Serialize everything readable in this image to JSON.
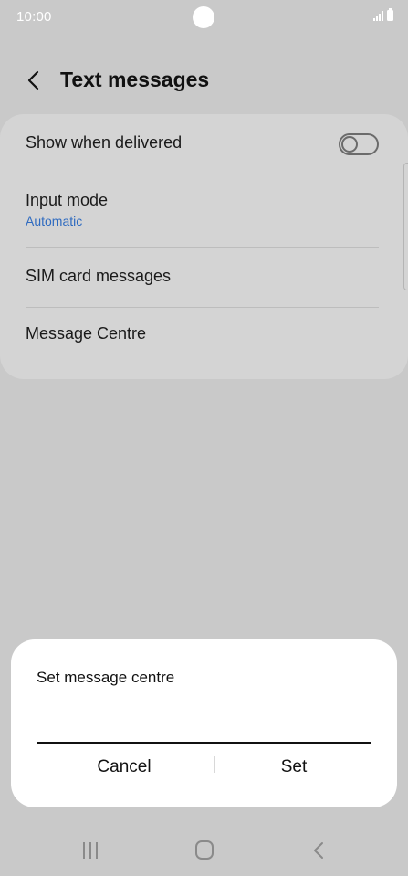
{
  "status_bar": {
    "time": "10:00",
    "icons": [
      "signal-icon",
      "battery-icon"
    ],
    "color": "#ffffff"
  },
  "header": {
    "back_icon": "chevron-left-icon",
    "title": "Text messages"
  },
  "settings": {
    "items": [
      {
        "title": "Show when delivered",
        "toggle": false
      },
      {
        "title": "Input mode",
        "subtitle": "Automatic"
      },
      {
        "title": "SIM card messages"
      },
      {
        "title": "Message Centre"
      }
    ],
    "subtitle_color": "#2f6bc0"
  },
  "dialog": {
    "title": "Set message centre",
    "input_value": "",
    "cancel_label": "Cancel",
    "set_label": "Set"
  },
  "nav_bar": {
    "icons": [
      "recent-apps-icon",
      "home-icon",
      "back-icon"
    ]
  },
  "colors": {
    "background_overlay": "#c9c9c9",
    "card": "#d4d4d4",
    "dialog": "#ffffff"
  }
}
